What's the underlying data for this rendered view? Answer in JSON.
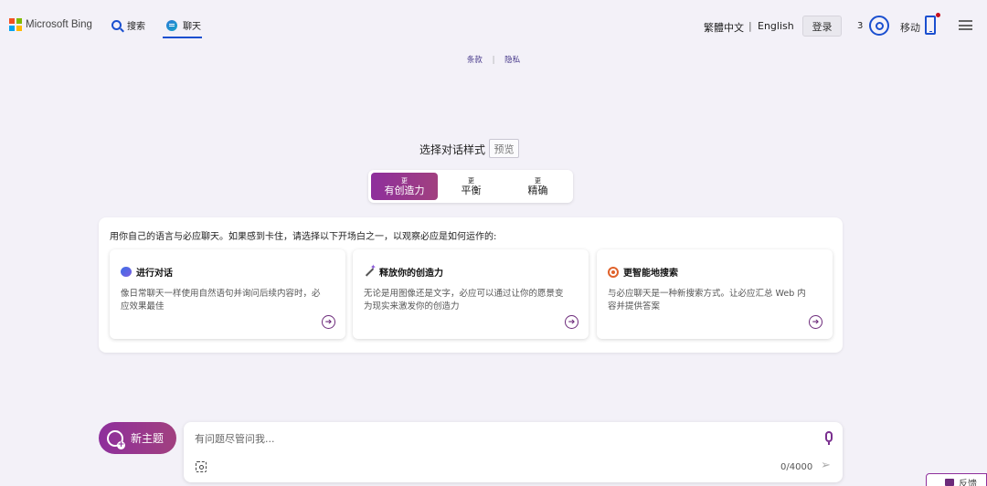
{
  "header": {
    "logo_text": "Microsoft Bing",
    "tab_search": "搜索",
    "tab_chat": "聊天",
    "lang_traditional": "繁體中文",
    "lang_separator": "|",
    "lang_english": "English",
    "login": "登录",
    "reward_points": "3",
    "mobile": "移动"
  },
  "legal": {
    "terms": "条款",
    "separator": "|",
    "privacy": "隐私"
  },
  "tone": {
    "title": "选择对话样式",
    "preview_badge": "预览",
    "options": [
      {
        "prefix": "更",
        "label": "有创造力"
      },
      {
        "prefix": "更",
        "label": "平衡"
      },
      {
        "prefix": "更",
        "label": "精确"
      }
    ],
    "selected": "有创造力"
  },
  "intro": {
    "text": "用你自己的语言与必应聊天。如果感到卡住，请选择以下开场白之一，以观察必应是如何运作的:",
    "cards": [
      {
        "icon": "chat-bubbles-icon",
        "title": "进行对话",
        "desc": "像日常聊天一样使用自然语句并询问后续内容时，必应效果最佳"
      },
      {
        "icon": "magic-wand-icon",
        "title": "释放你的创造力",
        "desc": "无论是用图像还是文字，必应可以通过让你的愿景变为现实来激发你的创造力"
      },
      {
        "icon": "target-icon",
        "title": "更智能地搜索",
        "desc": "与必应聊天是一种新搜索方式。让必应汇总 Web 内容并提供答案"
      }
    ]
  },
  "composer": {
    "new_topic": "新主题",
    "placeholder": "有问题尽管问我...",
    "char_count": "0/4000"
  },
  "feedback": "反馈",
  "colors": {
    "accent_gradient_start": "#8e2f9c",
    "accent_gradient_end": "#a1407f",
    "link_blue": "#1a4fcf",
    "background": "#f3f1f8"
  }
}
